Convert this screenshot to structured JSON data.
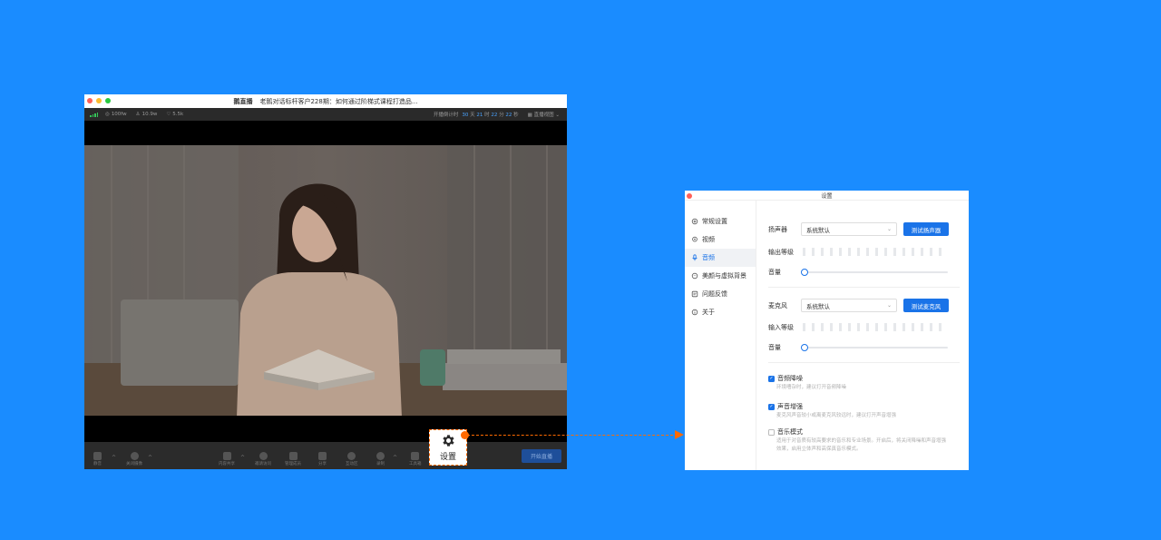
{
  "live_window": {
    "app_name": "鹅直播",
    "title": "老鹅对话标杆客户228期：如何通过阶梯式课程打造品...",
    "status": {
      "speed": "100fw",
      "viewers": "10.9w",
      "likes": "5.5k",
      "timer_label": "开播倒计时",
      "timer": [
        {
          "value": "30",
          "unit": "天"
        },
        {
          "value": "21",
          "unit": "时"
        },
        {
          "value": "22",
          "unit": "分"
        },
        {
          "value": "22",
          "unit": "秒"
        }
      ],
      "layout_label": "直播视图"
    },
    "toolbar": {
      "mute": "静音",
      "camera": "关闭摄像",
      "share": "内容共享",
      "invite": "邀请访问",
      "members": "管理成员",
      "distribute": "分享",
      "interact": "互动区",
      "record": "录制",
      "tools": "工具箱",
      "start": "开始直播"
    },
    "settings_label": "设置"
  },
  "dialog": {
    "title": "设置",
    "nav": [
      {
        "label": "常规设置",
        "icon": "gear-icon"
      },
      {
        "label": "视频",
        "icon": "camera-icon"
      },
      {
        "label": "音频",
        "icon": "mic-icon"
      },
      {
        "label": "美颜与虚拟背景",
        "icon": "beauty-icon"
      },
      {
        "label": "问题反馈",
        "icon": "feedback-icon"
      },
      {
        "label": "关于",
        "icon": "info-icon"
      }
    ],
    "active_nav": "音频",
    "speaker": {
      "label": "扬声器",
      "device": "系统默认",
      "test": "测试扬声器",
      "level_label": "输出等级",
      "volume_label": "音量",
      "volume": 0
    },
    "mic": {
      "label": "麦克风",
      "device": "系统默认",
      "test": "测试麦克风",
      "level_label": "输入等级",
      "volume_label": "音量",
      "volume": 0
    },
    "options": [
      {
        "label": "音频降噪",
        "checked": true,
        "desc": "环境嘈杂时，建议打开音频降噪"
      },
      {
        "label": "声音增强",
        "checked": true,
        "desc": "麦克风声音较小或离麦克风较远时，建议打开声音增强"
      },
      {
        "label": "音乐模式",
        "checked": false,
        "desc": "适用于对音质有较高要求的音乐和专业场景。开启后，将关闭降噪和声音增强效果，启用立体声和高保真音乐模式。"
      }
    ],
    "colors": {
      "accent": "#1a73e8",
      "highlight": "#ff6a00",
      "background": "#1a8cff"
    }
  }
}
